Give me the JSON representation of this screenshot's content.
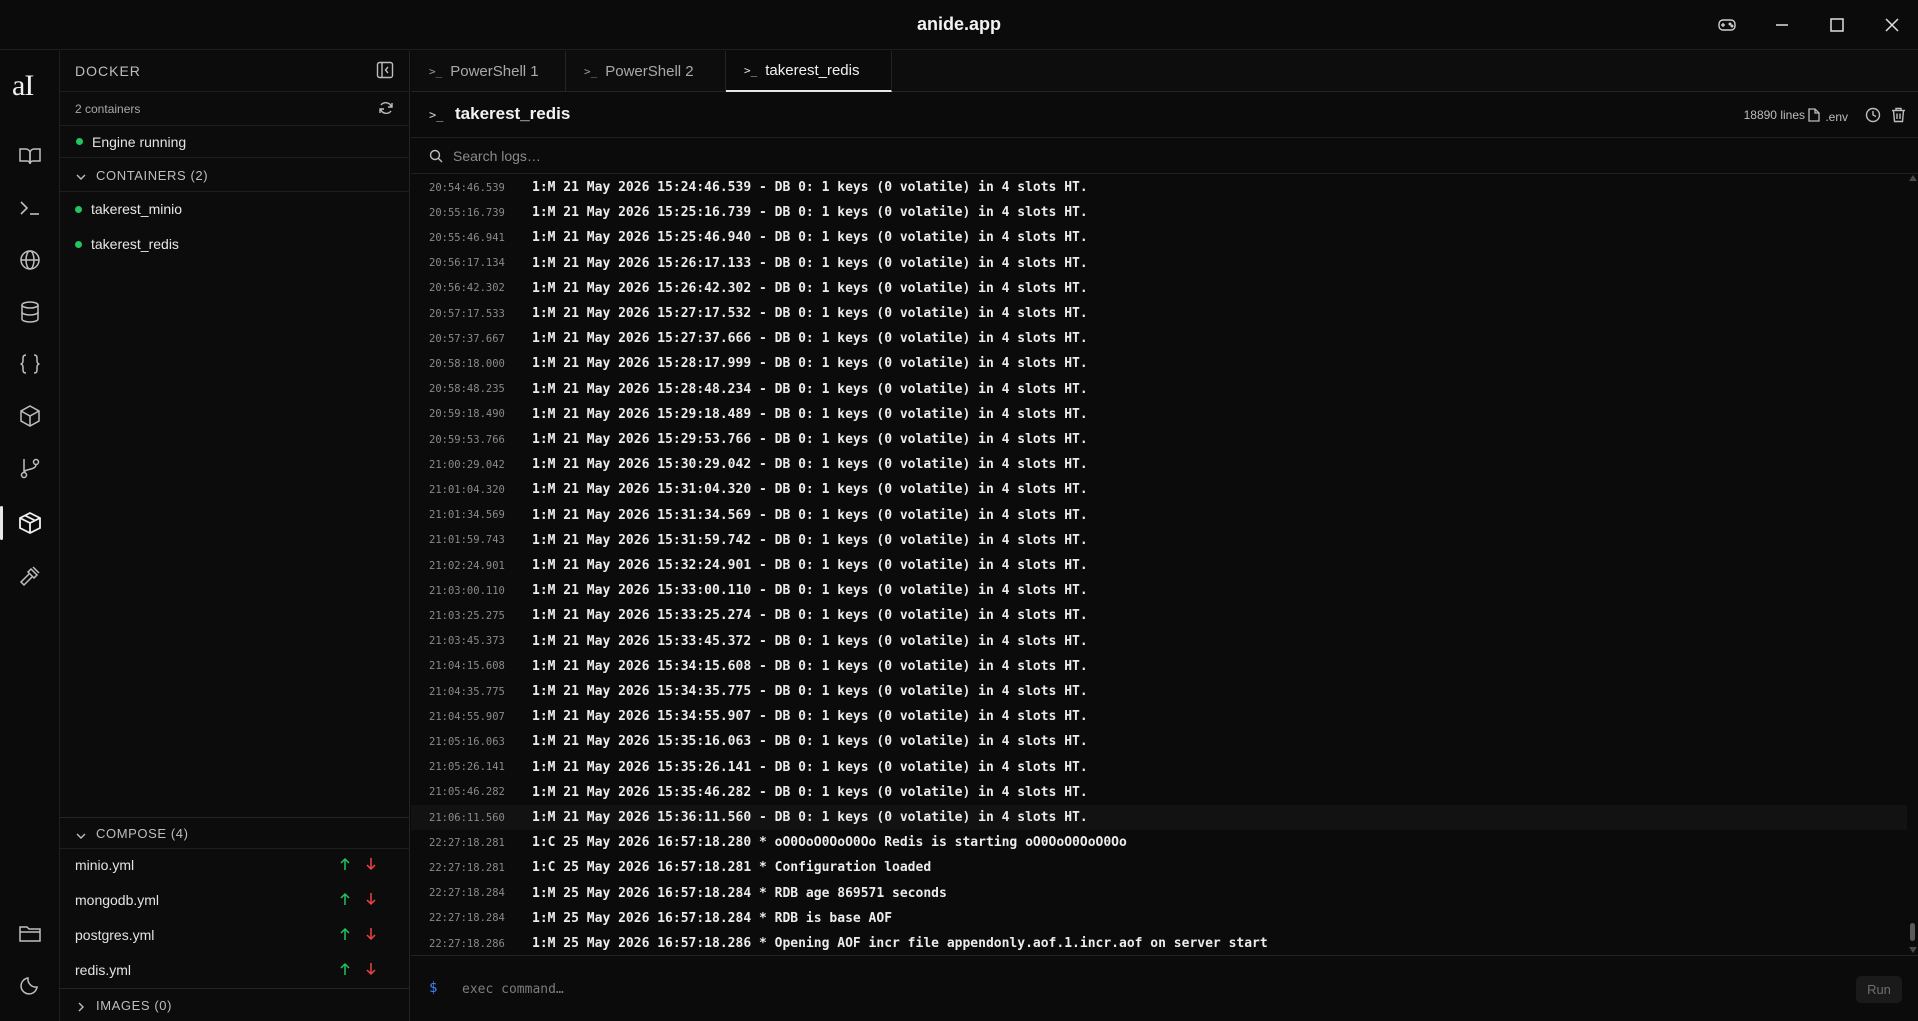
{
  "window": {
    "title": "anide.app",
    "controls": [
      "gamepad-icon",
      "minimize-icon",
      "maximize-icon",
      "close-icon"
    ]
  },
  "rail": {
    "logo": "aI",
    "icons": [
      "book-icon",
      "terminal-icon",
      "globe-icon",
      "database-icon",
      "braces-icon",
      "package-icon",
      "git-branch-icon",
      "docker-icon",
      "hammer-icon",
      "folder-icon",
      "moon-icon"
    ],
    "active": "docker-icon"
  },
  "sidebar": {
    "header": "DOCKER",
    "container_count": "2 containers",
    "engine_status": "Engine running",
    "containers_header": "CONTAINERS (2)",
    "containers": [
      {
        "name": "takerest_minio",
        "status_color": "#22c55e"
      },
      {
        "name": "takerest_redis",
        "status_color": "#22c55e"
      }
    ],
    "compose_header": "COMPOSE (4)",
    "compose": [
      {
        "name": "minio.yml"
      },
      {
        "name": "mongodb.yml"
      },
      {
        "name": "postgres.yml"
      },
      {
        "name": "redis.yml"
      }
    ],
    "images_header": "IMAGES (0)"
  },
  "tabs": [
    {
      "label": "PowerShell 1",
      "prompt": ">_",
      "active": false
    },
    {
      "label": "PowerShell 2",
      "prompt": ">_",
      "active": false
    },
    {
      "label": "takerest_redis",
      "prompt": ">_",
      "active": true
    }
  ],
  "log_panel": {
    "prompt": ">_",
    "container": "takerest_redis",
    "line_count": "18890 lines",
    "env_label": ".env",
    "search_placeholder": "Search logs…",
    "lines": [
      {
        "ts": "20:54:46.539",
        "msg": "1:M 21 May 2026 15:24:46.539 - DB 0: 1 keys (0 volatile) in 4 slots HT."
      },
      {
        "ts": "20:55:16.739",
        "msg": "1:M 21 May 2026 15:25:16.739 - DB 0: 1 keys (0 volatile) in 4 slots HT."
      },
      {
        "ts": "20:55:46.941",
        "msg": "1:M 21 May 2026 15:25:46.940 - DB 0: 1 keys (0 volatile) in 4 slots HT."
      },
      {
        "ts": "20:56:17.134",
        "msg": "1:M 21 May 2026 15:26:17.133 - DB 0: 1 keys (0 volatile) in 4 slots HT."
      },
      {
        "ts": "20:56:42.302",
        "msg": "1:M 21 May 2026 15:26:42.302 - DB 0: 1 keys (0 volatile) in 4 slots HT."
      },
      {
        "ts": "20:57:17.533",
        "msg": "1:M 21 May 2026 15:27:17.532 - DB 0: 1 keys (0 volatile) in 4 slots HT."
      },
      {
        "ts": "20:57:37.667",
        "msg": "1:M 21 May 2026 15:27:37.666 - DB 0: 1 keys (0 volatile) in 4 slots HT."
      },
      {
        "ts": "20:58:18.000",
        "msg": "1:M 21 May 2026 15:28:17.999 - DB 0: 1 keys (0 volatile) in 4 slots HT."
      },
      {
        "ts": "20:58:48.235",
        "msg": "1:M 21 May 2026 15:28:48.234 - DB 0: 1 keys (0 volatile) in 4 slots HT."
      },
      {
        "ts": "20:59:18.490",
        "msg": "1:M 21 May 2026 15:29:18.489 - DB 0: 1 keys (0 volatile) in 4 slots HT."
      },
      {
        "ts": "20:59:53.766",
        "msg": "1:M 21 May 2026 15:29:53.766 - DB 0: 1 keys (0 volatile) in 4 slots HT."
      },
      {
        "ts": "21:00:29.042",
        "msg": "1:M 21 May 2026 15:30:29.042 - DB 0: 1 keys (0 volatile) in 4 slots HT."
      },
      {
        "ts": "21:01:04.320",
        "msg": "1:M 21 May 2026 15:31:04.320 - DB 0: 1 keys (0 volatile) in 4 slots HT."
      },
      {
        "ts": "21:01:34.569",
        "msg": "1:M 21 May 2026 15:31:34.569 - DB 0: 1 keys (0 volatile) in 4 slots HT."
      },
      {
        "ts": "21:01:59.743",
        "msg": "1:M 21 May 2026 15:31:59.742 - DB 0: 1 keys (0 volatile) in 4 slots HT."
      },
      {
        "ts": "21:02:24.901",
        "msg": "1:M 21 May 2026 15:32:24.901 - DB 0: 1 keys (0 volatile) in 4 slots HT."
      },
      {
        "ts": "21:03:00.110",
        "msg": "1:M 21 May 2026 15:33:00.110 - DB 0: 1 keys (0 volatile) in 4 slots HT."
      },
      {
        "ts": "21:03:25.275",
        "msg": "1:M 21 May 2026 15:33:25.274 - DB 0: 1 keys (0 volatile) in 4 slots HT."
      },
      {
        "ts": "21:03:45.373",
        "msg": "1:M 21 May 2026 15:33:45.372 - DB 0: 1 keys (0 volatile) in 4 slots HT."
      },
      {
        "ts": "21:04:15.608",
        "msg": "1:M 21 May 2026 15:34:15.608 - DB 0: 1 keys (0 volatile) in 4 slots HT."
      },
      {
        "ts": "21:04:35.775",
        "msg": "1:M 21 May 2026 15:34:35.775 - DB 0: 1 keys (0 volatile) in 4 slots HT."
      },
      {
        "ts": "21:04:55.907",
        "msg": "1:M 21 May 2026 15:34:55.907 - DB 0: 1 keys (0 volatile) in 4 slots HT."
      },
      {
        "ts": "21:05:16.063",
        "msg": "1:M 21 May 2026 15:35:16.063 - DB 0: 1 keys (0 volatile) in 4 slots HT."
      },
      {
        "ts": "21:05:26.141",
        "msg": "1:M 21 May 2026 15:35:26.141 - DB 0: 1 keys (0 volatile) in 4 slots HT."
      },
      {
        "ts": "21:05:46.282",
        "msg": "1:M 21 May 2026 15:35:46.282 - DB 0: 1 keys (0 volatile) in 4 slots HT."
      },
      {
        "ts": "21:06:11.560",
        "msg": "1:M 21 May 2026 15:36:11.560 - DB 0: 1 keys (0 volatile) in 4 slots HT.",
        "highlighted": true
      },
      {
        "ts": "22:27:18.281",
        "msg": "1:C 25 May 2026 16:57:18.280 * oO0OoO0OoO0Oo Redis is starting oO0OoO0OoO0Oo"
      },
      {
        "ts": "22:27:18.281",
        "msg": "1:C 25 May 2026 16:57:18.281 * Configuration loaded"
      },
      {
        "ts": "22:27:18.284",
        "msg": "1:M 25 May 2026 16:57:18.284 * RDB age 869571 seconds"
      },
      {
        "ts": "22:27:18.284",
        "msg": "1:M 25 May 2026 16:57:18.284 * RDB is base AOF"
      },
      {
        "ts": "22:27:18.286",
        "msg": "1:M 25 May 2026 16:57:18.286 * Opening AOF incr file appendonly.aof.1.incr.aof on server start"
      }
    ]
  },
  "command_bar": {
    "prompt": "$",
    "placeholder": "exec command…",
    "run_label": "Run"
  },
  "colors": {
    "background": "#0b0b0b",
    "running": "#22c55e",
    "compose_up": "#22c55e",
    "compose_down": "#ef4444",
    "prompt_accent": "#3b82f6"
  }
}
